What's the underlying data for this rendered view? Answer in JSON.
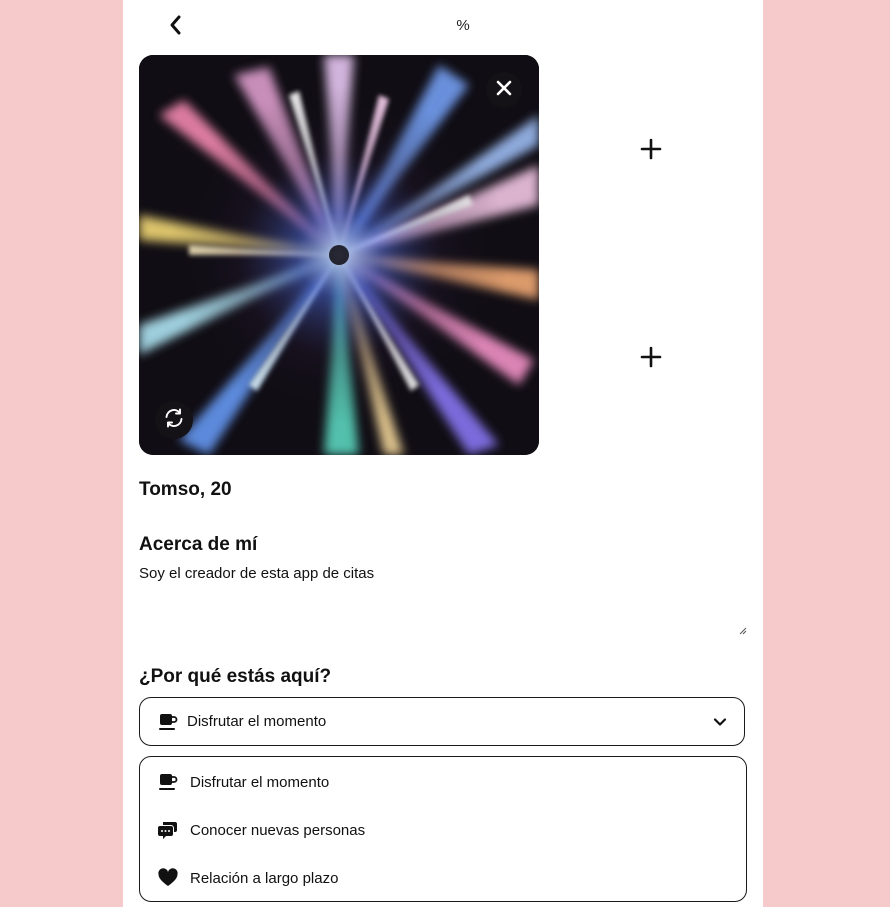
{
  "header": {
    "progress_text": "%"
  },
  "profile": {
    "name": "Tomso,",
    "age": "20"
  },
  "about": {
    "heading": "Acerca de mí",
    "text": "Soy el creador de esta app de citas"
  },
  "intent": {
    "heading": "¿Por qué estás aquí?",
    "selected_label": "Disfrutar el momento",
    "selected_icon": "coffee-cup-icon",
    "options": [
      {
        "label": "Disfrutar el momento",
        "icon": "coffee-cup-icon"
      },
      {
        "label": "Conocer nuevas personas",
        "icon": "chat-bubbles-icon"
      },
      {
        "label": "Relación a largo plazo",
        "icon": "heart-icon"
      }
    ]
  },
  "colors": {
    "page_background": "#f6c9ca",
    "panel_background": "#ffffff",
    "button_dark": "#141216"
  }
}
